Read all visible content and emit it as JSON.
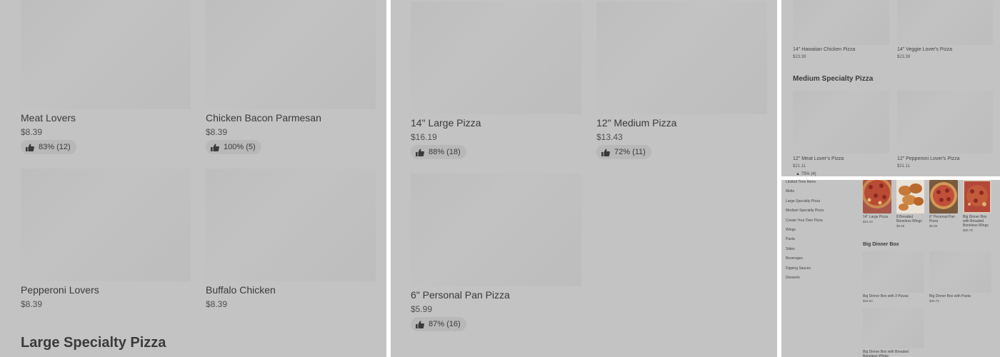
{
  "panel1": {
    "cards": [
      {
        "name": "Meat Lovers",
        "price": "$8.39",
        "rating": "83% (12)"
      },
      {
        "name": "Chicken Bacon Parmesan",
        "price": "$8.39",
        "rating": "100% (5)"
      },
      {
        "name": "Pepperoni Lovers",
        "price": "$8.39"
      },
      {
        "name": "Buffalo Chicken",
        "price": "$8.39"
      }
    ],
    "section_title": "Large Specialty Pizza"
  },
  "panel2": {
    "cards": [
      {
        "name": "14\" Large Pizza",
        "price": "$16.19",
        "rating": "88% (18)"
      },
      {
        "name": "12\" Medium Pizza",
        "price": "$13.43",
        "rating": "72% (11)"
      },
      {
        "name": "6\" Personal Pan Pizza",
        "price": "$5.99",
        "rating": "87% (16)"
      }
    ]
  },
  "panel3": {
    "top_cards": [
      {
        "name": "14\" Hawaiian Chicken Pizza",
        "price": "$23.39"
      },
      {
        "name": "14\" Veggie Lover's Pizza",
        "price": "$23.39"
      }
    ],
    "section_title": "Medium Specialty Pizza",
    "cards": [
      {
        "name": "12\" Meat Lover's Pizza",
        "price": "$21.11",
        "rating": "75% (4)"
      },
      {
        "name": "12\" Pepperoni Lover's Pizza",
        "price": "$21.11"
      }
    ]
  },
  "panel4": {
    "nav": [
      "Limited Time Items",
      "Melts",
      "Large Specialty Pizza",
      "Medium Specialty Pizza",
      "Create Your Own Pizza",
      "Wings",
      "Pasta",
      "Sides",
      "Beverages",
      "Dipping Sauces",
      "Desserts"
    ],
    "top_items": [
      {
        "name": "14\" Large Pizza",
        "price": "$16.19"
      },
      {
        "name": "8 Breaded Boneless Wings",
        "price": "$9.59"
      },
      {
        "name": "6\" Personal Pan Pizza",
        "price": "$5.99"
      },
      {
        "name": "Big Dinner Box with Breaded Boneless Wings",
        "price": "$28.79"
      }
    ],
    "section_title": "Big Dinner Box",
    "cards": [
      {
        "name": "Big Dinner Box with 3 Pizzas",
        "price": "$26.60"
      },
      {
        "name": "Big Dinner Box with Pasta",
        "price": "$28.79"
      },
      {
        "name": "Big Dinner Box with Breaded Boneless Wings"
      }
    ]
  },
  "colors": {
    "overlay": "#c3c3c3",
    "placeholder": "#bebebe",
    "rating_pill": "#b8b8b8",
    "divider": "#ffffff"
  },
  "icons": {
    "rating": "thumbs-up-icon"
  }
}
